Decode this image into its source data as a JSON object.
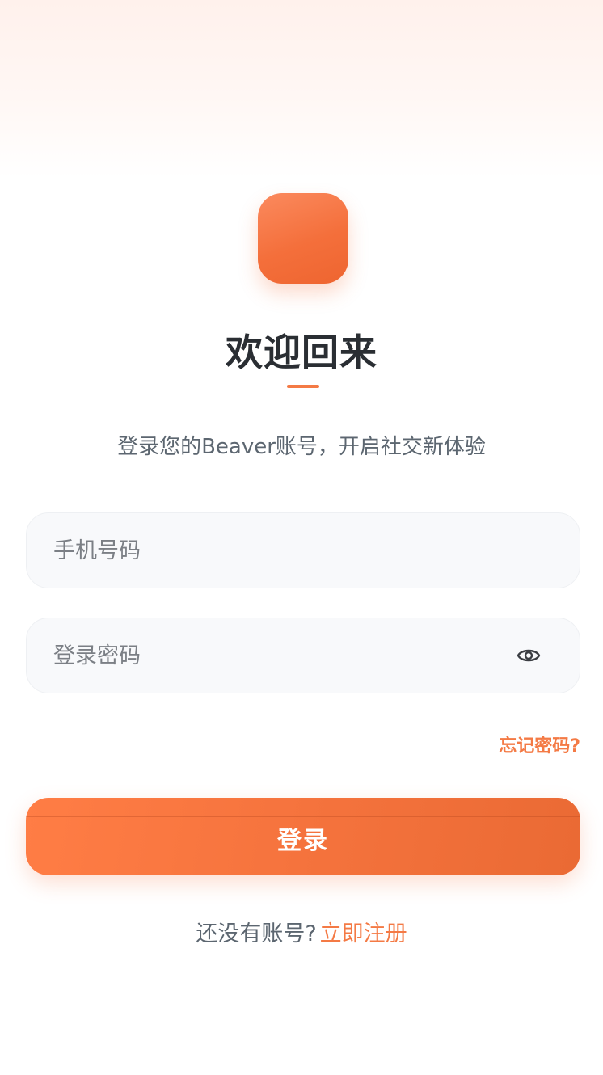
{
  "header": {
    "title": "欢迎回来",
    "subtitle": "登录您的Beaver账号，开启社交新体验"
  },
  "form": {
    "phone_placeholder": "手机号码",
    "password_placeholder": "登录密码",
    "forgot_password": "忘记密码?",
    "login_label": "登录"
  },
  "footer": {
    "no_account": "还没有账号?",
    "register": "立即注册"
  },
  "colors": {
    "accent": "#f47a45",
    "title": "#2a2e33",
    "muted": "#5c6670"
  },
  "icons": {
    "logo": "app-logo-icon",
    "password_toggle": "eye-icon"
  }
}
